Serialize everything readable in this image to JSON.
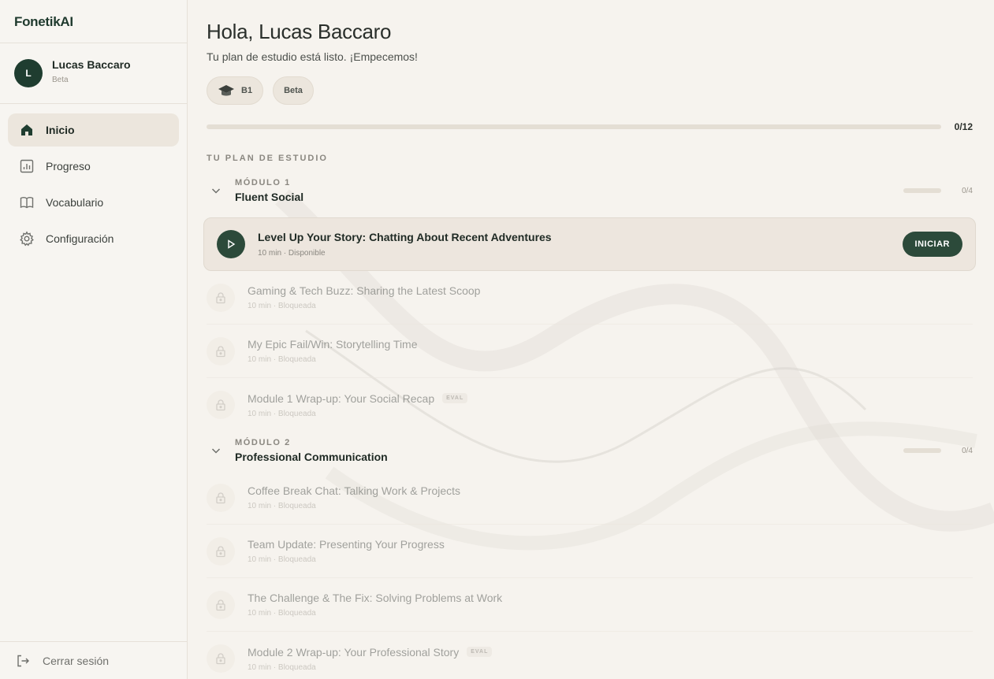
{
  "app": {
    "brand": "FonetikAI"
  },
  "user": {
    "initial": "L",
    "name": "Lucas Baccaro",
    "plan": "Beta"
  },
  "nav": [
    {
      "label": "Inicio",
      "icon": "home-icon",
      "active": true
    },
    {
      "label": "Progreso",
      "icon": "chart-icon",
      "active": false
    },
    {
      "label": "Vocabulario",
      "icon": "book-icon",
      "active": false
    },
    {
      "label": "Configuración",
      "icon": "gear-icon",
      "active": false
    }
  ],
  "logout": {
    "label": "Cerrar sesión",
    "icon": "logout-icon"
  },
  "header": {
    "greeting": "Hola, Lucas Baccaro",
    "subtitle": "Tu plan de estudio está listo. ¡Empecemos!",
    "level_chip": "B1",
    "plan_chip": "Beta"
  },
  "overall_progress": {
    "label": "0/12",
    "fraction": 0
  },
  "section_label": "TU PLAN DE ESTUDIO",
  "modules": [
    {
      "label": "MÓDULO 1",
      "title": "Fluent Social",
      "progress": "0/4",
      "fraction": 0,
      "active_lesson": {
        "title": "Level Up Your Story: Chatting About Recent Adventures",
        "meta": "10 min · Disponible",
        "button": "INICIAR"
      },
      "lessons": [
        {
          "title": "Gaming & Tech Buzz: Sharing the Latest Scoop",
          "meta": "10 min · Bloqueada",
          "badge": ""
        },
        {
          "title": "My Epic Fail/Win: Storytelling Time",
          "meta": "10 min · Bloqueada",
          "badge": ""
        },
        {
          "title": "Module 1 Wrap-up: Your Social Recap",
          "meta": "10 min · Bloqueada",
          "badge": "EVAL"
        }
      ]
    },
    {
      "label": "MÓDULO 2",
      "title": "Professional Communication",
      "progress": "0/4",
      "fraction": 0,
      "lessons": [
        {
          "title": "Coffee Break Chat: Talking Work & Projects",
          "meta": "10 min · Bloqueada",
          "badge": ""
        },
        {
          "title": "Team Update: Presenting Your Progress",
          "meta": "10 min · Bloqueada",
          "badge": ""
        },
        {
          "title": "The Challenge & The Fix: Solving Problems at Work",
          "meta": "10 min · Bloqueada",
          "badge": ""
        },
        {
          "title": "Module 2 Wrap-up: Your Professional Story",
          "meta": "10 min · Bloqueada",
          "badge": "EVAL"
        }
      ]
    }
  ],
  "colors": {
    "accent": "#2c4a3a",
    "background": "#f6f3ee",
    "sidebar": "#f7f5f1"
  }
}
